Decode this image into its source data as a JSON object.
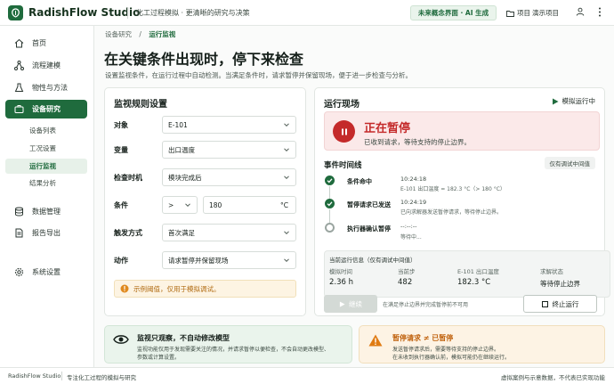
{
  "app": {
    "name": "RadishFlow Studio",
    "tagline": "化工过程模拟 · 更清晰的研究与决策",
    "concept_badge": "未来概念界面 · AI 生成",
    "projects": "项目",
    "demo_project": "演示项目"
  },
  "sidebar": {
    "items": [
      {
        "label": "首页",
        "icon": "home-icon"
      },
      {
        "label": "流程建模",
        "icon": "flow-icon"
      },
      {
        "label": "物性与方法",
        "icon": "flask-icon"
      },
      {
        "label": "设备研究",
        "icon": "briefcase-icon"
      },
      {
        "label": "数据管理",
        "icon": "database-icon"
      },
      {
        "label": "报告导出",
        "icon": "report-icon"
      },
      {
        "label": "系统设置",
        "icon": "gear-icon"
      }
    ],
    "sub_items": [
      "设备列表",
      "工况设置",
      "运行监视",
      "结果分析"
    ]
  },
  "breadcrumb": {
    "parent": "设备研究",
    "sep": "/",
    "current": "运行监视"
  },
  "page": {
    "title": "在关键条件出现时，停下来检查",
    "lead": "设置监视条件，在运行过程中自动检测。当满足条件时，请求暂停并保留现场，便于进一步检查与分析。"
  },
  "rules": {
    "title": "监视规则设置",
    "fields": [
      {
        "label": "对象",
        "value": "E-101"
      },
      {
        "label": "变量",
        "value": "出口温度"
      },
      {
        "label": "检查时机",
        "value": "模块完成后"
      },
      {
        "label": "条件",
        "operator": ">",
        "value": "180",
        "unit": "°C"
      },
      {
        "label": "触发方式",
        "value": "首次满足"
      },
      {
        "label": "动作",
        "value": "请求暂停并保留现场"
      }
    ],
    "note": "示例阈值，仅用于模拟调试。"
  },
  "runtime": {
    "title": "运行现场",
    "sim_status": "模拟运行中",
    "paused_title": "正在暂停",
    "paused_desc": "已收到请求，等待支持的停止边界。",
    "timeline_title": "事件时间线",
    "timeline_badge": "仅有调试中间值",
    "events": [
      {
        "title": "条件命中",
        "time": "10:24:18",
        "detail": "E-101 出口温度 = 182.3 °C（> 180 °C）",
        "state": "done"
      },
      {
        "title": "暂停请求已发送",
        "time": "10:24:19",
        "detail": "已向求解器发送暂停请求，等待停止边界。",
        "state": "done"
      },
      {
        "title": "执行器确认暂停",
        "time": "--:--:--",
        "detail": "等待中...",
        "state": "pending"
      }
    ],
    "info": {
      "title": "当前运行信息（仅有调试中间值）",
      "cols": [
        {
          "label": "模拟时间",
          "value": "2.36 h"
        },
        {
          "label": "当前步",
          "value": "482"
        },
        {
          "label": "E-101 出口温度",
          "value": "182.3 °C"
        },
        {
          "label": "求解状态",
          "value": "等待停止边界"
        }
      ]
    },
    "continue_label": "继续",
    "continue_hint": "在满足停止边界并完成暂停前不可用",
    "stop_label": "终止运行"
  },
  "callouts": {
    "observe_title": "监视只观察，不自动修改模型",
    "observe_text1": "监视功能仅用于发现需要关注的情况，并请求暂停以便检查，不会自动更改模型、",
    "observe_text2": "参数或计算设置。",
    "warn_title": "暂停请求 ≠ 已暂停",
    "warn_text1": "发送暂停请求后，需要等待支持的停止边界。",
    "warn_text2": "在未收到执行器确认前，模拟可能仍在继续运行。"
  },
  "footer": {
    "left": "RadishFlow Studio",
    "middle": "专注化工过程的模拟与研究",
    "right": "虚拟案例与示意数据，不代表已实现功能"
  },
  "colors": {
    "brand": "#1f6b3d",
    "pause": "#c42a2a",
    "warn": "#e07b12"
  }
}
